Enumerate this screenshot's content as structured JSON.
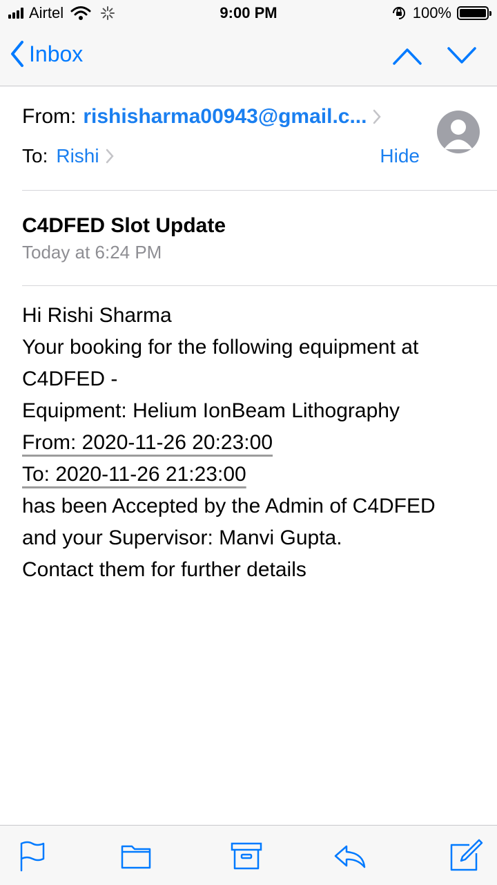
{
  "status_bar": {
    "carrier": "Airtel",
    "time": "9:00 PM",
    "battery": "100%"
  },
  "nav": {
    "back_label": "Inbox"
  },
  "header": {
    "from_label": "From:",
    "from_email": "rishisharma00943@gmail.c...",
    "to_label": "To:",
    "to_name": "Rishi",
    "hide_label": "Hide"
  },
  "message": {
    "subject": "C4DFED Slot Update",
    "date": "Today at 6:24 PM",
    "body_lines": [
      "Hi Rishi Sharma",
      "Your booking for the following equipment at",
      "C4DFED -",
      "Equipment: Helium IonBeam Lithography",
      "From: 2020-11-26 20:23:00",
      "To: 2020-11-26 21:23:00",
      "has been Accepted by the Admin of C4DFED",
      "and your Supervisor: Manvi Gupta.",
      "Contact them for further details"
    ]
  },
  "colors": {
    "accent": "#007aff",
    "link": "#1a7ff0",
    "muted": "#8e8e93"
  },
  "toolbar_icons": [
    "flag-icon",
    "folder-icon",
    "archive-icon",
    "reply-icon",
    "compose-icon"
  ]
}
